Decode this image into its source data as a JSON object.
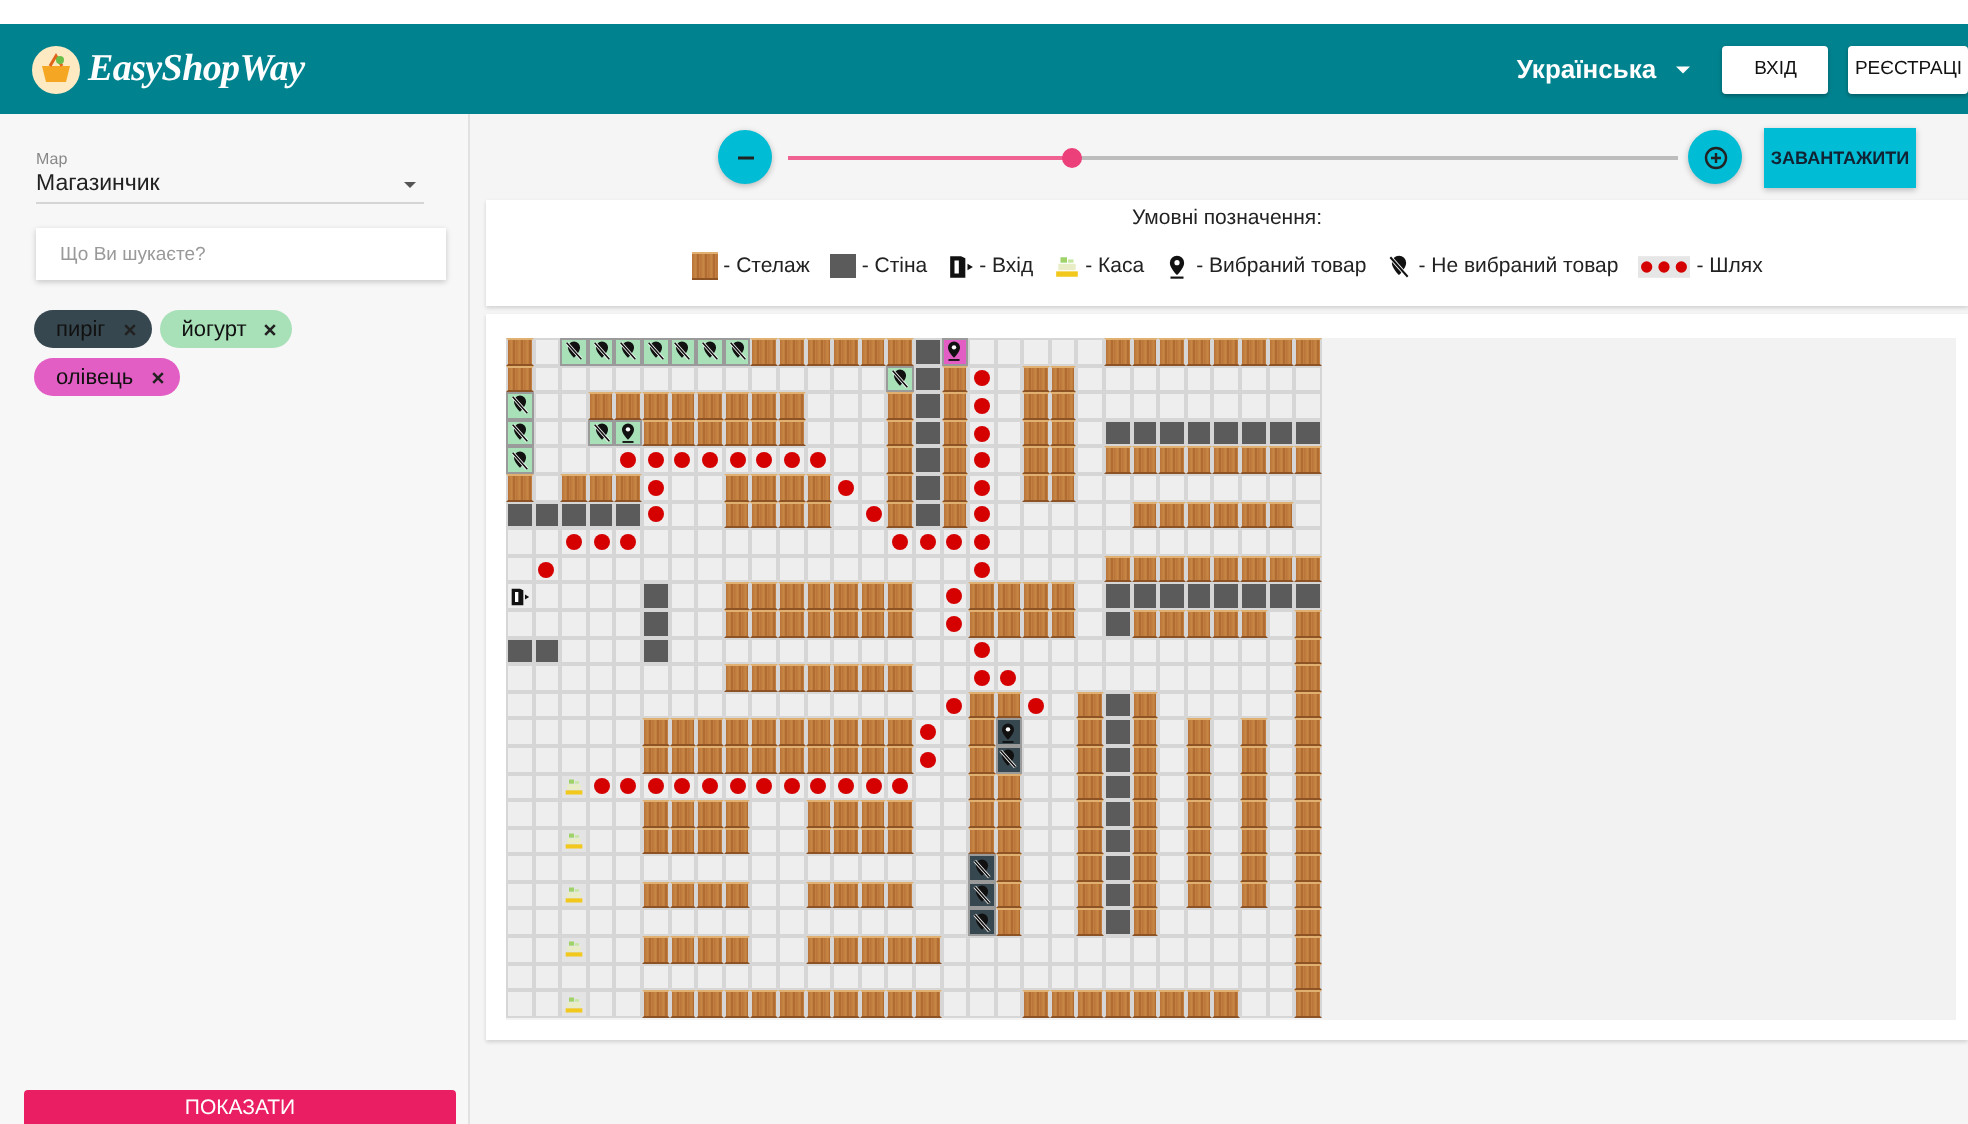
{
  "header": {
    "logo": "EasyShopWay",
    "language": "Українська",
    "buttons": [
      "ВХІД",
      "РЕЄСТРАЦІ"
    ]
  },
  "sidebar": {
    "map_select": {
      "label": "Мар",
      "value": "Магазинчик"
    },
    "search": {
      "placeholder": "Що Ви шукаєте?"
    },
    "chips": [
      {
        "label": "пиріг",
        "color": "#37474f"
      },
      {
        "label": "йогурт",
        "color": "#a8e0b8"
      },
      {
        "label": "олівець",
        "color": "#e25ec4"
      }
    ],
    "show_button": "ПОКАЗАТИ"
  },
  "zoom": {
    "level": 0.32
  },
  "load_button": "ЗАВАНТАЖИТИ",
  "legend": {
    "title": "Умовні позначення:",
    "items": [
      {
        "kind": "shelf",
        "label": "- Стелаж"
      },
      {
        "kind": "wall",
        "label": "- Стіна"
      },
      {
        "kind": "entrance",
        "label": "- Вхід"
      },
      {
        "kind": "checkout",
        "label": "- Каса"
      },
      {
        "kind": "selected",
        "label": "- Вибраний товар"
      },
      {
        "kind": "unselected",
        "label": "- Не вибраний товар"
      },
      {
        "kind": "path",
        "label": "- Шлях"
      }
    ]
  },
  "map": {
    "rows": [
      [
        {
          "kind": "shelf"
        },
        {
          "kind": "floor"
        },
        {
          "kind": "product",
          "selected": false,
          "color": "#a8e0b8"
        },
        {
          "kind": "product",
          "selected": false,
          "color": "#a8e0b8"
        },
        {
          "kind": "product",
          "selected": false,
          "color": "#a8e0b8"
        },
        {
          "kind": "product",
          "selected": false,
          "color": "#a8e0b8"
        },
        {
          "kind": "product",
          "selected": false,
          "color": "#a8e0b8"
        },
        {
          "kind": "product",
          "selected": false,
          "color": "#a8e0b8"
        },
        {
          "kind": "product",
          "selected": false,
          "color": "#a8e0b8"
        },
        {
          "kind": "shelf"
        },
        {
          "kind": "shelf"
        },
        {
          "kind": "shelf"
        },
        {
          "kind": "shelf"
        },
        {
          "kind": "shelf"
        },
        {
          "kind": "shelf"
        },
        {
          "kind": "wall"
        },
        {
          "kind": "product",
          "selected": true,
          "color": "#e25ec4"
        },
        {
          "kind": "floor"
        },
        {
          "kind": "floor"
        },
        {
          "kind": "floor"
        },
        {
          "kind": "floor"
        },
        {
          "kind": "floor"
        },
        {
          "kind": "shelf"
        },
        {
          "kind": "shelf"
        },
        {
          "kind": "shelf"
        },
        {
          "kind": "shelf"
        },
        {
          "kind": "shelf"
        },
        {
          "kind": "shelf"
        },
        {
          "kind": "shelf"
        },
        {
          "kind": "shelf"
        }
      ],
      [
        {
          "kind": "shelf"
        },
        {
          "kind": "floor"
        },
        {
          "kind": "floor"
        },
        {
          "kind": "floor"
        },
        {
          "kind": "floor"
        },
        {
          "kind": "floor"
        },
        {
          "kind": "floor"
        },
        {
          "kind": "floor"
        },
        {
          "kind": "floor"
        },
        {
          "kind": "floor"
        },
        {
          "kind": "floor"
        },
        {
          "kind": "floor"
        },
        {
          "kind": "floor"
        },
        {
          "kind": "floor"
        },
        {
          "kind": "product",
          "selected": false,
          "color": "#a8e0b8"
        },
        {
          "kind": "wall"
        },
        {
          "kind": "shelf"
        },
        {
          "kind": "path"
        },
        {
          "kind": "floor"
        },
        {
          "kind": "shelf"
        },
        {
          "kind": "shelf"
        },
        {
          "kind": "floor"
        },
        {
          "kind": "floor"
        },
        {
          "kind": "floor"
        },
        {
          "kind": "floor"
        },
        {
          "kind": "floor"
        },
        {
          "kind": "floor"
        },
        {
          "kind": "floor"
        },
        {
          "kind": "floor"
        },
        {
          "kind": "floor"
        }
      ],
      [
        {
          "kind": "product",
          "selected": false,
          "color": "#a8e0b8"
        },
        {
          "kind": "floor"
        },
        {
          "kind": "floor"
        },
        {
          "kind": "shelf"
        },
        {
          "kind": "shelf"
        },
        {
          "kind": "shelf"
        },
        {
          "kind": "shelf"
        },
        {
          "kind": "shelf"
        },
        {
          "kind": "shelf"
        },
        {
          "kind": "shelf"
        },
        {
          "kind": "shelf"
        },
        {
          "kind": "floor"
        },
        {
          "kind": "floor"
        },
        {
          "kind": "floor"
        },
        {
          "kind": "shelf"
        },
        {
          "kind": "wall"
        },
        {
          "kind": "shelf"
        },
        {
          "kind": "path"
        },
        {
          "kind": "floor"
        },
        {
          "kind": "shelf"
        },
        {
          "kind": "shelf"
        },
        {
          "kind": "floor"
        },
        {
          "kind": "floor"
        },
        {
          "kind": "floor"
        },
        {
          "kind": "floor"
        },
        {
          "kind": "floor"
        },
        {
          "kind": "floor"
        },
        {
          "kind": "floor"
        },
        {
          "kind": "floor"
        },
        {
          "kind": "floor"
        }
      ],
      [
        {
          "kind": "product",
          "selected": false,
          "color": "#a8e0b8"
        },
        {
          "kind": "floor"
        },
        {
          "kind": "floor"
        },
        {
          "kind": "product",
          "selected": false,
          "color": "#a8e0b8"
        },
        {
          "kind": "product",
          "selected": true,
          "color": "#a8e0b8"
        },
        {
          "kind": "shelf"
        },
        {
          "kind": "shelf"
        },
        {
          "kind": "shelf"
        },
        {
          "kind": "shelf"
        },
        {
          "kind": "shelf"
        },
        {
          "kind": "shelf"
        },
        {
          "kind": "floor"
        },
        {
          "kind": "floor"
        },
        {
          "kind": "floor"
        },
        {
          "kind": "shelf"
        },
        {
          "kind": "wall"
        },
        {
          "kind": "shelf"
        },
        {
          "kind": "path"
        },
        {
          "kind": "floor"
        },
        {
          "kind": "shelf"
        },
        {
          "kind": "shelf"
        },
        {
          "kind": "floor"
        },
        {
          "kind": "wall"
        },
        {
          "kind": "wall"
        },
        {
          "kind": "wall"
        },
        {
          "kind": "wall"
        },
        {
          "kind": "wall"
        },
        {
          "kind": "wall"
        },
        {
          "kind": "wall"
        },
        {
          "kind": "wall"
        }
      ],
      [
        {
          "kind": "product",
          "selected": false,
          "color": "#a8e0b8"
        },
        {
          "kind": "floor"
        },
        {
          "kind": "floor"
        },
        {
          "kind": "floor"
        },
        {
          "kind": "path"
        },
        {
          "kind": "path"
        },
        {
          "kind": "path"
        },
        {
          "kind": "path"
        },
        {
          "kind": "path"
        },
        {
          "kind": "path"
        },
        {
          "kind": "path"
        },
        {
          "kind": "path"
        },
        {
          "kind": "floor"
        },
        {
          "kind": "floor"
        },
        {
          "kind": "shelf"
        },
        {
          "kind": "wall"
        },
        {
          "kind": "shelf"
        },
        {
          "kind": "path"
        },
        {
          "kind": "floor"
        },
        {
          "kind": "shelf"
        },
        {
          "kind": "shelf"
        },
        {
          "kind": "floor"
        },
        {
          "kind": "shelf"
        },
        {
          "kind": "shelf"
        },
        {
          "kind": "shelf"
        },
        {
          "kind": "shelf"
        },
        {
          "kind": "shelf"
        },
        {
          "kind": "shelf"
        },
        {
          "kind": "shelf"
        },
        {
          "kind": "shelf"
        }
      ],
      [
        {
          "kind": "shelf"
        },
        {
          "kind": "floor"
        },
        {
          "kind": "shelf"
        },
        {
          "kind": "shelf"
        },
        {
          "kind": "shelf"
        },
        {
          "kind": "path"
        },
        {
          "kind": "floor"
        },
        {
          "kind": "floor"
        },
        {
          "kind": "shelf"
        },
        {
          "kind": "shelf"
        },
        {
          "kind": "shelf"
        },
        {
          "kind": "shelf"
        },
        {
          "kind": "path"
        },
        {
          "kind": "floor"
        },
        {
          "kind": "shelf"
        },
        {
          "kind": "wall"
        },
        {
          "kind": "shelf"
        },
        {
          "kind": "path"
        },
        {
          "kind": "floor"
        },
        {
          "kind": "shelf"
        },
        {
          "kind": "shelf"
        },
        {
          "kind": "floor"
        },
        {
          "kind": "floor"
        },
        {
          "kind": "floor"
        },
        {
          "kind": "floor"
        },
        {
          "kind": "floor"
        },
        {
          "kind": "floor"
        },
        {
          "kind": "floor"
        },
        {
          "kind": "floor"
        },
        {
          "kind": "floor"
        }
      ],
      [
        {
          "kind": "wall"
        },
        {
          "kind": "wall"
        },
        {
          "kind": "wall"
        },
        {
          "kind": "wall"
        },
        {
          "kind": "wall"
        },
        {
          "kind": "path"
        },
        {
          "kind": "floor"
        },
        {
          "kind": "floor"
        },
        {
          "kind": "shelf"
        },
        {
          "kind": "shelf"
        },
        {
          "kind": "shelf"
        },
        {
          "kind": "shelf"
        },
        {
          "kind": "floor"
        },
        {
          "kind": "path"
        },
        {
          "kind": "shelf"
        },
        {
          "kind": "wall"
        },
        {
          "kind": "shelf"
        },
        {
          "kind": "path"
        },
        {
          "kind": "floor"
        },
        {
          "kind": "floor"
        },
        {
          "kind": "floor"
        },
        {
          "kind": "floor"
        },
        {
          "kind": "floor"
        },
        {
          "kind": "shelf"
        },
        {
          "kind": "shelf"
        },
        {
          "kind": "shelf"
        },
        {
          "kind": "shelf"
        },
        {
          "kind": "shelf"
        },
        {
          "kind": "shelf"
        },
        {
          "kind": "floor"
        }
      ],
      [
        {
          "kind": "floor"
        },
        {
          "kind": "floor"
        },
        {
          "kind": "path"
        },
        {
          "kind": "path"
        },
        {
          "kind": "path"
        },
        {
          "kind": "floor"
        },
        {
          "kind": "floor"
        },
        {
          "kind": "floor"
        },
        {
          "kind": "floor"
        },
        {
          "kind": "floor"
        },
        {
          "kind": "floor"
        },
        {
          "kind": "floor"
        },
        {
          "kind": "floor"
        },
        {
          "kind": "floor"
        },
        {
          "kind": "path"
        },
        {
          "kind": "path"
        },
        {
          "kind": "path"
        },
        {
          "kind": "path"
        },
        {
          "kind": "floor"
        },
        {
          "kind": "floor"
        },
        {
          "kind": "floor"
        },
        {
          "kind": "floor"
        },
        {
          "kind": "floor"
        },
        {
          "kind": "floor"
        },
        {
          "kind": "floor"
        },
        {
          "kind": "floor"
        },
        {
          "kind": "floor"
        },
        {
          "kind": "floor"
        },
        {
          "kind": "floor"
        },
        {
          "kind": "floor"
        }
      ],
      [
        {
          "kind": "floor"
        },
        {
          "kind": "path"
        },
        {
          "kind": "floor"
        },
        {
          "kind": "floor"
        },
        {
          "kind": "floor"
        },
        {
          "kind": "floor"
        },
        {
          "kind": "floor"
        },
        {
          "kind": "floor"
        },
        {
          "kind": "floor"
        },
        {
          "kind": "floor"
        },
        {
          "kind": "floor"
        },
        {
          "kind": "floor"
        },
        {
          "kind": "floor"
        },
        {
          "kind": "floor"
        },
        {
          "kind": "floor"
        },
        {
          "kind": "floor"
        },
        {
          "kind": "floor"
        },
        {
          "kind": "path"
        },
        {
          "kind": "floor"
        },
        {
          "kind": "floor"
        },
        {
          "kind": "floor"
        },
        {
          "kind": "floor"
        },
        {
          "kind": "shelf"
        },
        {
          "kind": "shelf"
        },
        {
          "kind": "shelf"
        },
        {
          "kind": "shelf"
        },
        {
          "kind": "shelf"
        },
        {
          "kind": "shelf"
        },
        {
          "kind": "shelf"
        },
        {
          "kind": "shelf"
        }
      ],
      [
        {
          "kind": "entrance"
        },
        {
          "kind": "floor"
        },
        {
          "kind": "floor"
        },
        {
          "kind": "floor"
        },
        {
          "kind": "floor"
        },
        {
          "kind": "wall"
        },
        {
          "kind": "floor"
        },
        {
          "kind": "floor"
        },
        {
          "kind": "shelf"
        },
        {
          "kind": "shelf"
        },
        {
          "kind": "shelf"
        },
        {
          "kind": "shelf"
        },
        {
          "kind": "shelf"
        },
        {
          "kind": "shelf"
        },
        {
          "kind": "shelf"
        },
        {
          "kind": "floor"
        },
        {
          "kind": "path"
        },
        {
          "kind": "shelf"
        },
        {
          "kind": "shelf"
        },
        {
          "kind": "shelf"
        },
        {
          "kind": "shelf"
        },
        {
          "kind": "floor"
        },
        {
          "kind": "wall"
        },
        {
          "kind": "wall"
        },
        {
          "kind": "wall"
        },
        {
          "kind": "wall"
        },
        {
          "kind": "wall"
        },
        {
          "kind": "wall"
        },
        {
          "kind": "wall"
        },
        {
          "kind": "wall"
        }
      ],
      [
        {
          "kind": "floor"
        },
        {
          "kind": "floor"
        },
        {
          "kind": "floor"
        },
        {
          "kind": "floor"
        },
        {
          "kind": "floor"
        },
        {
          "kind": "wall"
        },
        {
          "kind": "floor"
        },
        {
          "kind": "floor"
        },
        {
          "kind": "shelf"
        },
        {
          "kind": "shelf"
        },
        {
          "kind": "shelf"
        },
        {
          "kind": "shelf"
        },
        {
          "kind": "shelf"
        },
        {
          "kind": "shelf"
        },
        {
          "kind": "shelf"
        },
        {
          "kind": "floor"
        },
        {
          "kind": "path"
        },
        {
          "kind": "shelf"
        },
        {
          "kind": "shelf"
        },
        {
          "kind": "shelf"
        },
        {
          "kind": "shelf"
        },
        {
          "kind": "floor"
        },
        {
          "kind": "wall"
        },
        {
          "kind": "shelf"
        },
        {
          "kind": "shelf"
        },
        {
          "kind": "shelf"
        },
        {
          "kind": "shelf"
        },
        {
          "kind": "shelf"
        },
        {
          "kind": "floor"
        },
        {
          "kind": "shelf"
        }
      ],
      [
        {
          "kind": "wall"
        },
        {
          "kind": "wall"
        },
        {
          "kind": "floor"
        },
        {
          "kind": "floor"
        },
        {
          "kind": "floor"
        },
        {
          "kind": "wall"
        },
        {
          "kind": "floor"
        },
        {
          "kind": "floor"
        },
        {
          "kind": "floor"
        },
        {
          "kind": "floor"
        },
        {
          "kind": "floor"
        },
        {
          "kind": "floor"
        },
        {
          "kind": "floor"
        },
        {
          "kind": "floor"
        },
        {
          "kind": "floor"
        },
        {
          "kind": "floor"
        },
        {
          "kind": "floor"
        },
        {
          "kind": "path"
        },
        {
          "kind": "floor"
        },
        {
          "kind": "floor"
        },
        {
          "kind": "floor"
        },
        {
          "kind": "floor"
        },
        {
          "kind": "floor"
        },
        {
          "kind": "floor"
        },
        {
          "kind": "floor"
        },
        {
          "kind": "floor"
        },
        {
          "kind": "floor"
        },
        {
          "kind": "floor"
        },
        {
          "kind": "floor"
        },
        {
          "kind": "shelf"
        }
      ],
      [
        {
          "kind": "floor"
        },
        {
          "kind": "floor"
        },
        {
          "kind": "floor"
        },
        {
          "kind": "floor"
        },
        {
          "kind": "floor"
        },
        {
          "kind": "floor"
        },
        {
          "kind": "floor"
        },
        {
          "kind": "floor"
        },
        {
          "kind": "shelf"
        },
        {
          "kind": "shelf"
        },
        {
          "kind": "shelf"
        },
        {
          "kind": "shelf"
        },
        {
          "kind": "shelf"
        },
        {
          "kind": "shelf"
        },
        {
          "kind": "shelf"
        },
        {
          "kind": "floor"
        },
        {
          "kind": "floor"
        },
        {
          "kind": "path"
        },
        {
          "kind": "path"
        },
        {
          "kind": "floor"
        },
        {
          "kind": "floor"
        },
        {
          "kind": "floor"
        },
        {
          "kind": "floor"
        },
        {
          "kind": "floor"
        },
        {
          "kind": "floor"
        },
        {
          "kind": "floor"
        },
        {
          "kind": "floor"
        },
        {
          "kind": "floor"
        },
        {
          "kind": "floor"
        },
        {
          "kind": "shelf"
        }
      ],
      [
        {
          "kind": "floor"
        },
        {
          "kind": "floor"
        },
        {
          "kind": "floor"
        },
        {
          "kind": "floor"
        },
        {
          "kind": "floor"
        },
        {
          "kind": "floor"
        },
        {
          "kind": "floor"
        },
        {
          "kind": "floor"
        },
        {
          "kind": "floor"
        },
        {
          "kind": "floor"
        },
        {
          "kind": "floor"
        },
        {
          "kind": "floor"
        },
        {
          "kind": "floor"
        },
        {
          "kind": "floor"
        },
        {
          "kind": "floor"
        },
        {
          "kind": "floor"
        },
        {
          "kind": "path"
        },
        {
          "kind": "shelf"
        },
        {
          "kind": "shelf"
        },
        {
          "kind": "path"
        },
        {
          "kind": "floor"
        },
        {
          "kind": "shelf"
        },
        {
          "kind": "wall"
        },
        {
          "kind": "shelf"
        },
        {
          "kind": "floor"
        },
        {
          "kind": "floor"
        },
        {
          "kind": "floor"
        },
        {
          "kind": "floor"
        },
        {
          "kind": "floor"
        },
        {
          "kind": "shelf"
        }
      ],
      [
        {
          "kind": "floor"
        },
        {
          "kind": "floor"
        },
        {
          "kind": "floor"
        },
        {
          "kind": "floor"
        },
        {
          "kind": "floor"
        },
        {
          "kind": "shelf"
        },
        {
          "kind": "shelf"
        },
        {
          "kind": "shelf"
        },
        {
          "kind": "shelf"
        },
        {
          "kind": "shelf"
        },
        {
          "kind": "shelf"
        },
        {
          "kind": "shelf"
        },
        {
          "kind": "shelf"
        },
        {
          "kind": "shelf"
        },
        {
          "kind": "shelf"
        },
        {
          "kind": "path"
        },
        {
          "kind": "floor"
        },
        {
          "kind": "shelf"
        },
        {
          "kind": "product",
          "selected": true,
          "color": "#37474f"
        },
        {
          "kind": "floor"
        },
        {
          "kind": "floor"
        },
        {
          "kind": "shelf"
        },
        {
          "kind": "wall"
        },
        {
          "kind": "shelf"
        },
        {
          "kind": "floor"
        },
        {
          "kind": "shelf"
        },
        {
          "kind": "floor"
        },
        {
          "kind": "shelf"
        },
        {
          "kind": "floor"
        },
        {
          "kind": "shelf"
        }
      ],
      [
        {
          "kind": "floor"
        },
        {
          "kind": "floor"
        },
        {
          "kind": "floor"
        },
        {
          "kind": "floor"
        },
        {
          "kind": "floor"
        },
        {
          "kind": "shelf"
        },
        {
          "kind": "shelf"
        },
        {
          "kind": "shelf"
        },
        {
          "kind": "shelf"
        },
        {
          "kind": "shelf"
        },
        {
          "kind": "shelf"
        },
        {
          "kind": "shelf"
        },
        {
          "kind": "shelf"
        },
        {
          "kind": "shelf"
        },
        {
          "kind": "shelf"
        },
        {
          "kind": "path"
        },
        {
          "kind": "floor"
        },
        {
          "kind": "shelf"
        },
        {
          "kind": "product",
          "selected": false,
          "color": "#37474f"
        },
        {
          "kind": "floor"
        },
        {
          "kind": "floor"
        },
        {
          "kind": "shelf"
        },
        {
          "kind": "wall"
        },
        {
          "kind": "shelf"
        },
        {
          "kind": "floor"
        },
        {
          "kind": "shelf"
        },
        {
          "kind": "floor"
        },
        {
          "kind": "shelf"
        },
        {
          "kind": "floor"
        },
        {
          "kind": "shelf"
        }
      ],
      [
        {
          "kind": "floor"
        },
        {
          "kind": "floor"
        },
        {
          "kind": "checkout"
        },
        {
          "kind": "path"
        },
        {
          "kind": "path"
        },
        {
          "kind": "path"
        },
        {
          "kind": "path"
        },
        {
          "kind": "path"
        },
        {
          "kind": "path"
        },
        {
          "kind": "path"
        },
        {
          "kind": "path"
        },
        {
          "kind": "path"
        },
        {
          "kind": "path"
        },
        {
          "kind": "path"
        },
        {
          "kind": "path"
        },
        {
          "kind": "floor"
        },
        {
          "kind": "floor"
        },
        {
          "kind": "shelf"
        },
        {
          "kind": "shelf"
        },
        {
          "kind": "floor"
        },
        {
          "kind": "floor"
        },
        {
          "kind": "shelf"
        },
        {
          "kind": "wall"
        },
        {
          "kind": "shelf"
        },
        {
          "kind": "floor"
        },
        {
          "kind": "shelf"
        },
        {
          "kind": "floor"
        },
        {
          "kind": "shelf"
        },
        {
          "kind": "floor"
        },
        {
          "kind": "shelf"
        }
      ],
      [
        {
          "kind": "floor"
        },
        {
          "kind": "floor"
        },
        {
          "kind": "floor"
        },
        {
          "kind": "floor"
        },
        {
          "kind": "floor"
        },
        {
          "kind": "shelf"
        },
        {
          "kind": "shelf"
        },
        {
          "kind": "shelf"
        },
        {
          "kind": "shelf"
        },
        {
          "kind": "floor"
        },
        {
          "kind": "floor"
        },
        {
          "kind": "shelf"
        },
        {
          "kind": "shelf"
        },
        {
          "kind": "shelf"
        },
        {
          "kind": "shelf"
        },
        {
          "kind": "floor"
        },
        {
          "kind": "floor"
        },
        {
          "kind": "shelf"
        },
        {
          "kind": "shelf"
        },
        {
          "kind": "floor"
        },
        {
          "kind": "floor"
        },
        {
          "kind": "shelf"
        },
        {
          "kind": "wall"
        },
        {
          "kind": "shelf"
        },
        {
          "kind": "floor"
        },
        {
          "kind": "shelf"
        },
        {
          "kind": "floor"
        },
        {
          "kind": "shelf"
        },
        {
          "kind": "floor"
        },
        {
          "kind": "shelf"
        }
      ],
      [
        {
          "kind": "floor"
        },
        {
          "kind": "floor"
        },
        {
          "kind": "checkout"
        },
        {
          "kind": "floor"
        },
        {
          "kind": "floor"
        },
        {
          "kind": "shelf"
        },
        {
          "kind": "shelf"
        },
        {
          "kind": "shelf"
        },
        {
          "kind": "shelf"
        },
        {
          "kind": "floor"
        },
        {
          "kind": "floor"
        },
        {
          "kind": "shelf"
        },
        {
          "kind": "shelf"
        },
        {
          "kind": "shelf"
        },
        {
          "kind": "shelf"
        },
        {
          "kind": "floor"
        },
        {
          "kind": "floor"
        },
        {
          "kind": "shelf"
        },
        {
          "kind": "shelf"
        },
        {
          "kind": "floor"
        },
        {
          "kind": "floor"
        },
        {
          "kind": "shelf"
        },
        {
          "kind": "wall"
        },
        {
          "kind": "shelf"
        },
        {
          "kind": "floor"
        },
        {
          "kind": "shelf"
        },
        {
          "kind": "floor"
        },
        {
          "kind": "shelf"
        },
        {
          "kind": "floor"
        },
        {
          "kind": "shelf"
        }
      ],
      [
        {
          "kind": "floor"
        },
        {
          "kind": "floor"
        },
        {
          "kind": "floor"
        },
        {
          "kind": "floor"
        },
        {
          "kind": "floor"
        },
        {
          "kind": "floor"
        },
        {
          "kind": "floor"
        },
        {
          "kind": "floor"
        },
        {
          "kind": "floor"
        },
        {
          "kind": "floor"
        },
        {
          "kind": "floor"
        },
        {
          "kind": "floor"
        },
        {
          "kind": "floor"
        },
        {
          "kind": "floor"
        },
        {
          "kind": "floor"
        },
        {
          "kind": "floor"
        },
        {
          "kind": "floor"
        },
        {
          "kind": "product",
          "selected": false,
          "color": "#37474f"
        },
        {
          "kind": "shelf"
        },
        {
          "kind": "floor"
        },
        {
          "kind": "floor"
        },
        {
          "kind": "shelf"
        },
        {
          "kind": "wall"
        },
        {
          "kind": "shelf"
        },
        {
          "kind": "floor"
        },
        {
          "kind": "shelf"
        },
        {
          "kind": "floor"
        },
        {
          "kind": "shelf"
        },
        {
          "kind": "floor"
        },
        {
          "kind": "shelf"
        }
      ],
      [
        {
          "kind": "floor"
        },
        {
          "kind": "floor"
        },
        {
          "kind": "checkout"
        },
        {
          "kind": "floor"
        },
        {
          "kind": "floor"
        },
        {
          "kind": "shelf"
        },
        {
          "kind": "shelf"
        },
        {
          "kind": "shelf"
        },
        {
          "kind": "shelf"
        },
        {
          "kind": "floor"
        },
        {
          "kind": "floor"
        },
        {
          "kind": "shelf"
        },
        {
          "kind": "shelf"
        },
        {
          "kind": "shelf"
        },
        {
          "kind": "shelf"
        },
        {
          "kind": "floor"
        },
        {
          "kind": "floor"
        },
        {
          "kind": "product",
          "selected": false,
          "color": "#37474f"
        },
        {
          "kind": "shelf"
        },
        {
          "kind": "floor"
        },
        {
          "kind": "floor"
        },
        {
          "kind": "shelf"
        },
        {
          "kind": "wall"
        },
        {
          "kind": "shelf"
        },
        {
          "kind": "floor"
        },
        {
          "kind": "shelf"
        },
        {
          "kind": "floor"
        },
        {
          "kind": "shelf"
        },
        {
          "kind": "floor"
        },
        {
          "kind": "shelf"
        }
      ],
      [
        {
          "kind": "floor"
        },
        {
          "kind": "floor"
        },
        {
          "kind": "floor"
        },
        {
          "kind": "floor"
        },
        {
          "kind": "floor"
        },
        {
          "kind": "floor"
        },
        {
          "kind": "floor"
        },
        {
          "kind": "floor"
        },
        {
          "kind": "floor"
        },
        {
          "kind": "floor"
        },
        {
          "kind": "floor"
        },
        {
          "kind": "floor"
        },
        {
          "kind": "floor"
        },
        {
          "kind": "floor"
        },
        {
          "kind": "floor"
        },
        {
          "kind": "floor"
        },
        {
          "kind": "floor"
        },
        {
          "kind": "product",
          "selected": false,
          "color": "#37474f"
        },
        {
          "kind": "shelf"
        },
        {
          "kind": "floor"
        },
        {
          "kind": "floor"
        },
        {
          "kind": "shelf"
        },
        {
          "kind": "wall"
        },
        {
          "kind": "shelf"
        },
        {
          "kind": "floor"
        },
        {
          "kind": "floor"
        },
        {
          "kind": "floor"
        },
        {
          "kind": "floor"
        },
        {
          "kind": "floor"
        },
        {
          "kind": "shelf"
        }
      ],
      [
        {
          "kind": "floor"
        },
        {
          "kind": "floor"
        },
        {
          "kind": "checkout"
        },
        {
          "kind": "floor"
        },
        {
          "kind": "floor"
        },
        {
          "kind": "shelf"
        },
        {
          "kind": "shelf"
        },
        {
          "kind": "shelf"
        },
        {
          "kind": "shelf"
        },
        {
          "kind": "floor"
        },
        {
          "kind": "floor"
        },
        {
          "kind": "shelf"
        },
        {
          "kind": "shelf"
        },
        {
          "kind": "shelf"
        },
        {
          "kind": "shelf"
        },
        {
          "kind": "shelf"
        },
        {
          "kind": "floor"
        },
        {
          "kind": "floor"
        },
        {
          "kind": "floor"
        },
        {
          "kind": "floor"
        },
        {
          "kind": "floor"
        },
        {
          "kind": "floor"
        },
        {
          "kind": "floor"
        },
        {
          "kind": "floor"
        },
        {
          "kind": "floor"
        },
        {
          "kind": "floor"
        },
        {
          "kind": "floor"
        },
        {
          "kind": "floor"
        },
        {
          "kind": "floor"
        },
        {
          "kind": "shelf"
        }
      ],
      [
        {
          "kind": "floor"
        },
        {
          "kind": "floor"
        },
        {
          "kind": "floor"
        },
        {
          "kind": "floor"
        },
        {
          "kind": "floor"
        },
        {
          "kind": "floor"
        },
        {
          "kind": "floor"
        },
        {
          "kind": "floor"
        },
        {
          "kind": "floor"
        },
        {
          "kind": "floor"
        },
        {
          "kind": "floor"
        },
        {
          "kind": "floor"
        },
        {
          "kind": "floor"
        },
        {
          "kind": "floor"
        },
        {
          "kind": "floor"
        },
        {
          "kind": "floor"
        },
        {
          "kind": "floor"
        },
        {
          "kind": "floor"
        },
        {
          "kind": "floor"
        },
        {
          "kind": "floor"
        },
        {
          "kind": "floor"
        },
        {
          "kind": "floor"
        },
        {
          "kind": "floor"
        },
        {
          "kind": "floor"
        },
        {
          "kind": "floor"
        },
        {
          "kind": "floor"
        },
        {
          "kind": "floor"
        },
        {
          "kind": "floor"
        },
        {
          "kind": "floor"
        },
        {
          "kind": "shelf"
        }
      ],
      [
        {
          "kind": "floor"
        },
        {
          "kind": "floor"
        },
        {
          "kind": "checkout"
        },
        {
          "kind": "floor"
        },
        {
          "kind": "floor"
        },
        {
          "kind": "shelf"
        },
        {
          "kind": "shelf"
        },
        {
          "kind": "shelf"
        },
        {
          "kind": "shelf"
        },
        {
          "kind": "shelf"
        },
        {
          "kind": "shelf"
        },
        {
          "kind": "shelf"
        },
        {
          "kind": "shelf"
        },
        {
          "kind": "shelf"
        },
        {
          "kind": "shelf"
        },
        {
          "kind": "shelf"
        },
        {
          "kind": "floor"
        },
        {
          "kind": "floor"
        },
        {
          "kind": "floor"
        },
        {
          "kind": "shelf"
        },
        {
          "kind": "shelf"
        },
        {
          "kind": "shelf"
        },
        {
          "kind": "shelf"
        },
        {
          "kind": "shelf"
        },
        {
          "kind": "shelf"
        },
        {
          "kind": "shelf"
        },
        {
          "kind": "shelf"
        },
        {
          "kind": "floor"
        },
        {
          "kind": "floor"
        },
        {
          "kind": "shelf"
        }
      ]
    ]
  }
}
